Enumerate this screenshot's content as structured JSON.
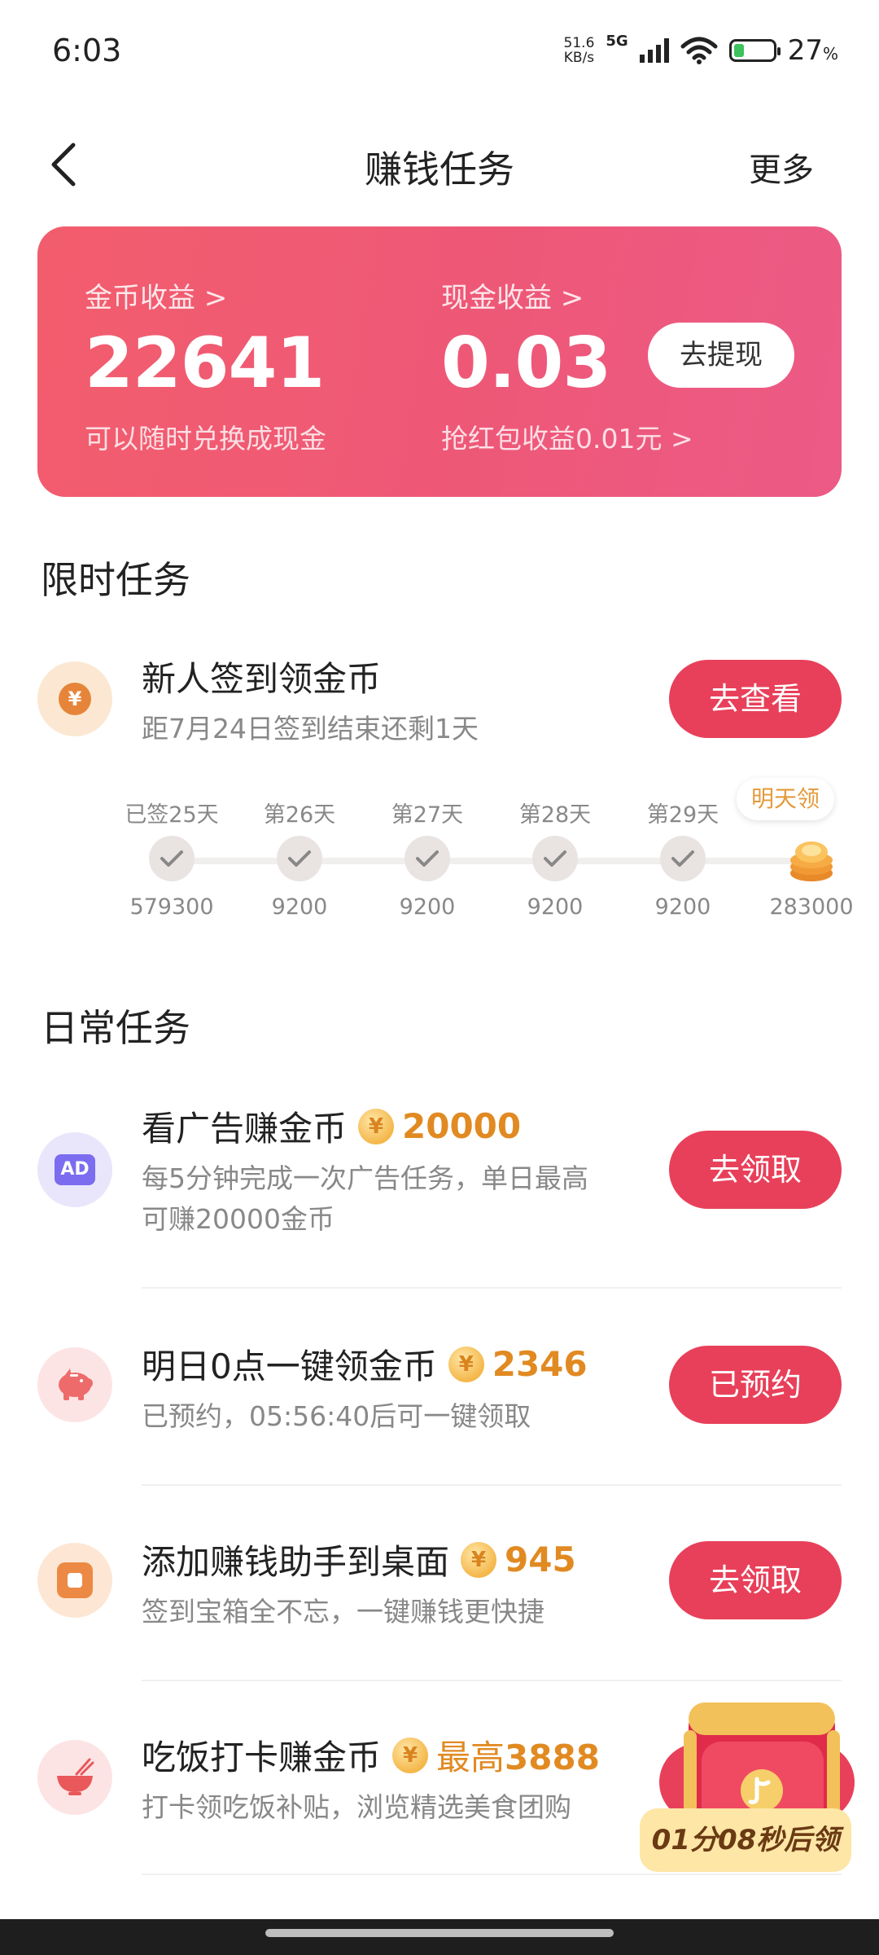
{
  "status_bar": {
    "time": "6:03",
    "speed_value": "51.6",
    "speed_unit": "KB/s",
    "network": "5G",
    "battery_pct": "27",
    "battery_unit": "%"
  },
  "nav": {
    "title": "赚钱任务",
    "more": "更多"
  },
  "earnings": {
    "coin_label": "金币收益 >",
    "coin_value": "22641",
    "coin_note": "可以随时兑换成现金",
    "cash_label": "现金收益 >",
    "cash_value": "0.03",
    "cash_note": "抢红包收益0.01元 >",
    "withdraw_button": "去提现"
  },
  "limited": {
    "section_title": "限时任务",
    "task": {
      "title": "新人签到领金币",
      "subtitle": "距7月24日签到结束还剩1天",
      "button": "去查看"
    },
    "checkin_days": [
      {
        "label": "已签25天",
        "value": "579300"
      },
      {
        "label": "第26天",
        "value": "9200"
      },
      {
        "label": "第27天",
        "value": "9200"
      },
      {
        "label": "第28天",
        "value": "9200"
      },
      {
        "label": "第29天",
        "value": "9200"
      },
      {
        "label": "明天领",
        "value": "283000"
      }
    ]
  },
  "daily": {
    "section_title": "日常任务",
    "tasks": [
      {
        "title": "看广告赚金币",
        "reward": "20000",
        "subtitle_line1": "每5分钟完成一次广告任务，单日最高",
        "subtitle_line2": "可赚20000金币",
        "button": "去领取",
        "icon_text": "AD"
      },
      {
        "title": "明日0点一键领金币",
        "reward": "2346",
        "subtitle_line1": "已预约，05:56:40后可一键领取",
        "button": "已预约"
      },
      {
        "title": "添加赚钱助手到桌面",
        "reward": "945",
        "subtitle_line1": "签到宝箱全不忘，一键赚钱更快捷",
        "button": "去领取"
      },
      {
        "title": "吃饭打卡赚金币",
        "reward_prefix": "最高",
        "reward": "3888",
        "subtitle_line1": "打卡领吃饭补贴，浏览精选美食团购"
      }
    ]
  },
  "floating": {
    "timer": "01分08秒后领"
  },
  "coin_symbol": "¥",
  "colors": {
    "accent": "#e8405a",
    "reward": "#e18a22",
    "card_start": "#f25d6d",
    "card_end": "#ec5a86"
  }
}
